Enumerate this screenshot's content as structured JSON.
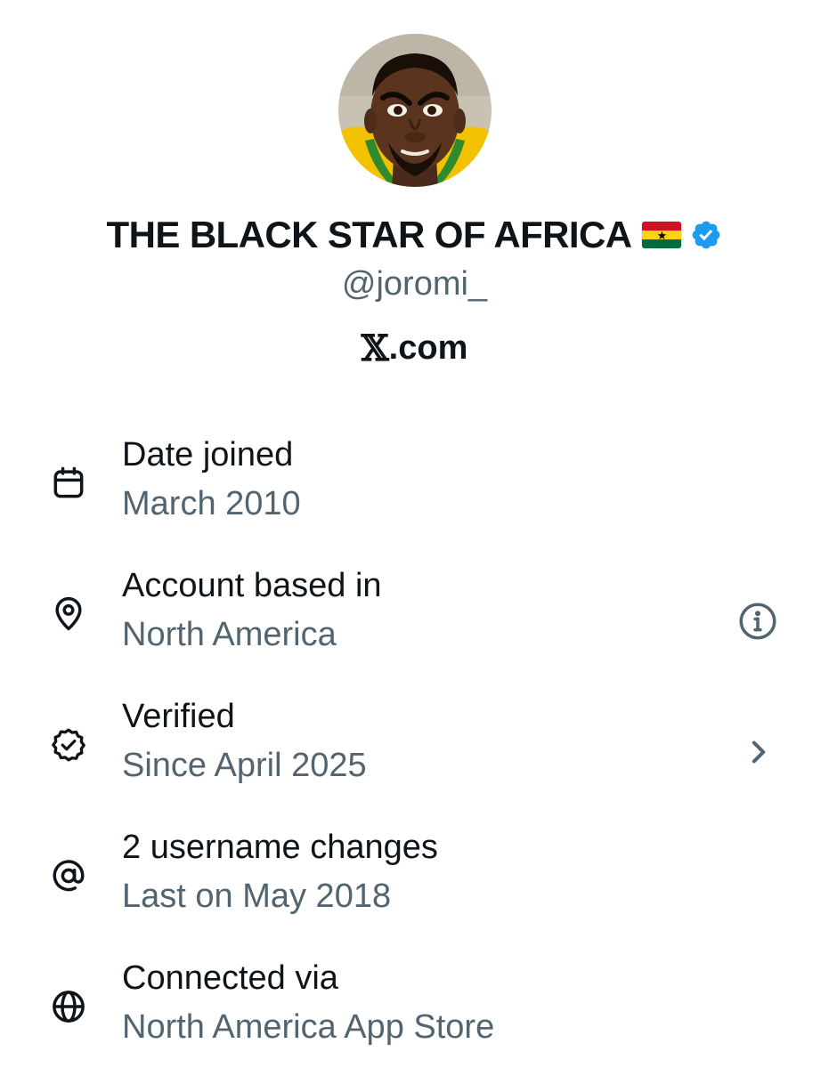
{
  "profile": {
    "display_name": "THE BLACK STAR OF AFRICA",
    "flag_icon": "ghana-flag-icon",
    "verified_icon": "verified-badge-icon",
    "handle": "@joromi_",
    "connected_platform": {
      "logo": "𝕏",
      "text": ".com"
    }
  },
  "details": [
    {
      "icon": "calendar-icon",
      "label": "Date joined",
      "value": "March 2010"
    },
    {
      "icon": "location-pin-icon",
      "label": "Account based in",
      "value": "North America",
      "trailing_icon": "info-icon"
    },
    {
      "icon": "verified-outline-icon",
      "label": "Verified",
      "value": "Since April 2025",
      "trailing_icon": "chevron-right-icon"
    },
    {
      "icon": "at-sign-icon",
      "label": "2 username changes",
      "value": "Last on May 2018"
    },
    {
      "icon": "globe-icon",
      "label": "Connected via",
      "value": "North America App Store"
    }
  ],
  "colors": {
    "text_primary": "#0f1419",
    "text_secondary": "#536471",
    "verified_blue": "#1d9bf0",
    "background": "#ffffff"
  }
}
